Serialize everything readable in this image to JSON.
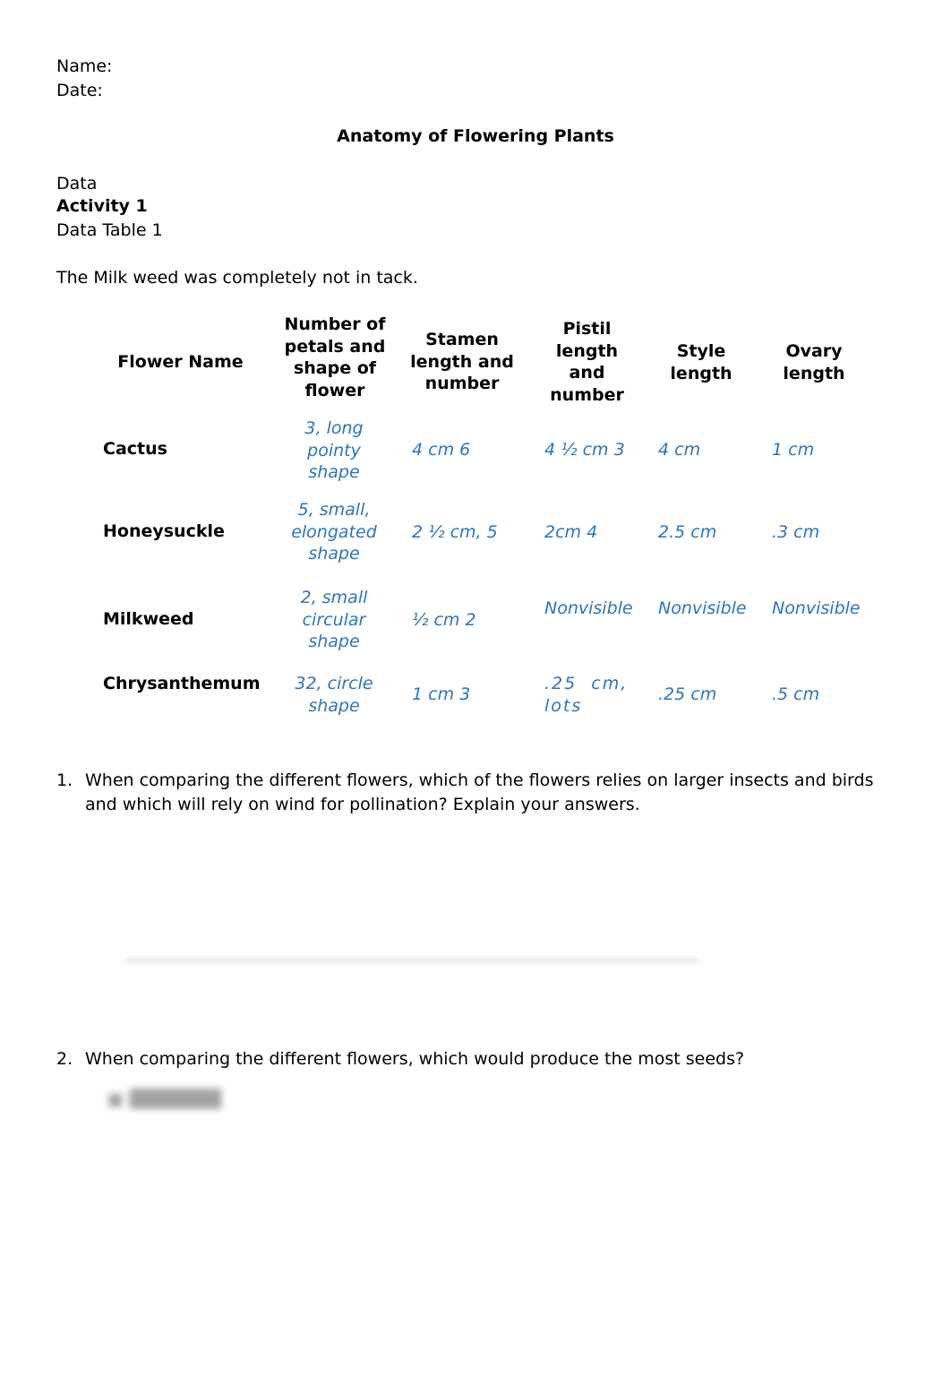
{
  "header": {
    "name_label": "Name:",
    "date_label": "Date:"
  },
  "title": "Anatomy of Flowering Plants",
  "section": {
    "data_label": "Data",
    "activity_label": "Activity 1",
    "table_label": "Data Table 1",
    "note": "The Milk weed was completely not in tack."
  },
  "table": {
    "columns": [
      "Flower Name",
      "Number of petals and shape of flower",
      "Stamen length and number",
      "Pistil length and number",
      "Style length",
      "Ovary length"
    ],
    "rows": [
      {
        "flower": "Cactus",
        "petals": "3, long pointy shape",
        "stamen": "4 cm 6",
        "pistil": "4 ½ cm 3",
        "style": "4 cm",
        "ovary": "1 cm"
      },
      {
        "flower": "Honeysuckle",
        "petals": "5, small, elongated shape",
        "stamen": "2 ½ cm, 5",
        "pistil": "2cm 4",
        "style": "2.5 cm",
        "ovary": ".3 cm"
      },
      {
        "flower": "Milkweed",
        "petals": "2, small circular shape",
        "stamen": "½ cm 2",
        "pistil": "Nonvisible",
        "style": "Nonvisible",
        "ovary": "Nonvisible"
      },
      {
        "flower": "Chrysanthemum",
        "petals": "32, circle shape",
        "stamen": "1 cm 3",
        "pistil": ".25  cm, lots",
        "style": ".25 cm",
        "ovary": ".5 cm"
      }
    ],
    "answer_color": "#2e74b5"
  },
  "questions": [
    {
      "number": "1.",
      "text": "When comparing the different flowers, which of the flowers relies on larger insects and birds and which will rely on wind for pollination? Explain your answers."
    },
    {
      "number": "2.",
      "text": "When comparing the different flowers, which would produce the most seeds?"
    }
  ]
}
